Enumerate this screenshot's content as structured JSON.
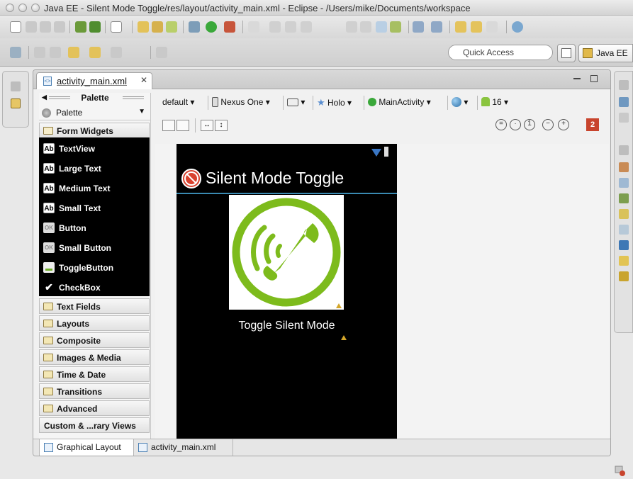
{
  "window": {
    "title": "Java EE - Silent Mode Toggle/res/layout/activity_main.xml - Eclipse - /Users/mike/Documents/workspace"
  },
  "toolbar": {
    "quick_access_placeholder": "Quick Access",
    "perspective_label": "Java EE"
  },
  "editor": {
    "tab_label": "activity_main.xml",
    "tab_close": "✕"
  },
  "palette": {
    "header": "Palette",
    "selector_label": "Palette",
    "open_category": "Form Widgets",
    "widgets": [
      {
        "label": "TextView",
        "icon": "Ab"
      },
      {
        "label": "Large Text",
        "icon": "Ab"
      },
      {
        "label": "Medium Text",
        "icon": "Ab"
      },
      {
        "label": "Small Text",
        "icon": "Ab"
      },
      {
        "label": "Button",
        "icon": "OK"
      },
      {
        "label": "Small Button",
        "icon": "OK"
      },
      {
        "label": "ToggleButton",
        "icon": "toggle"
      },
      {
        "label": "CheckBox",
        "icon": "check"
      }
    ],
    "categories": [
      "Text Fields",
      "Layouts",
      "Composite",
      "Images & Media",
      "Time & Date",
      "Transitions",
      "Advanced",
      "Custom & ...rary Views"
    ]
  },
  "canvas_toolbar": {
    "config": "default",
    "device": "Nexus One",
    "theme": "Holo",
    "activity": "MainActivity",
    "api": "16",
    "error_count": "2"
  },
  "device_preview": {
    "app_title": "Silent Mode Toggle",
    "toggle_text": "Toggle Silent Mode",
    "accent_color": "#3a8ab2",
    "phone_icon_color": "#7dbb1c"
  },
  "bottom_tabs": {
    "graphical": "Graphical Layout",
    "xml": "activity_main.xml"
  }
}
